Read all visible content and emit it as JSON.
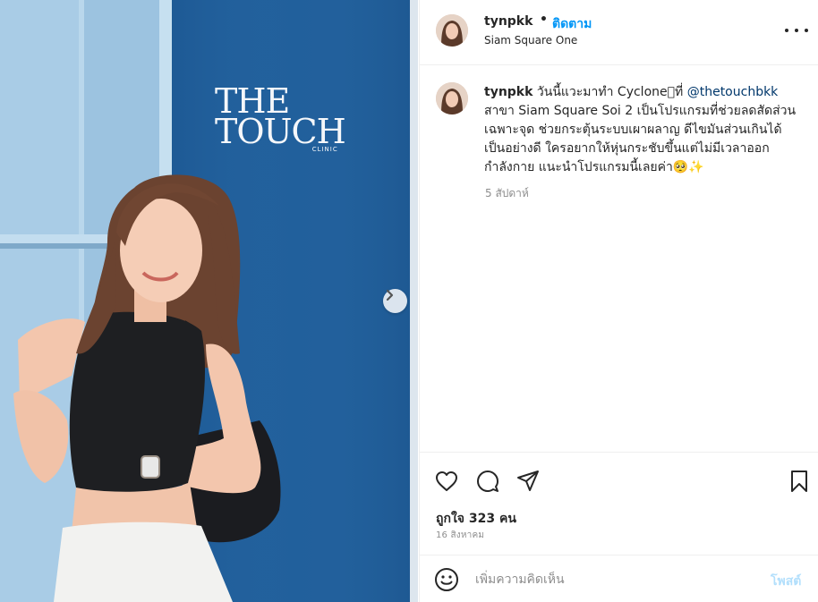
{
  "photo": {
    "sign_line1": "THE",
    "sign_line2": "TOUCH",
    "sign_line3": "CLINIC"
  },
  "header": {
    "username": "tynpkk",
    "separator": "•",
    "follow_label": "ติดตาม",
    "location": "Siam Square One"
  },
  "caption": {
    "username": "tynpkk",
    "text_before_mention": "วันนี้แวะมาทำ Cyclone⃣ที่ ",
    "mention": "@thetouchbkk",
    "text_after_mention": " สาขา Siam Square Soi 2 เป็นโปรแกรมที่ช่วยลดสัดส่วนเฉพาะจุด ช่วยกระตุ้นระบบเผาผลาญ ดีไขมันส่วนเกินได้เป็นอย่างดี ใครอยากให้หุ่นกระชับขึ้นแต่ไม่มีเวลาออกกำลังกาย แนะนำโปรแกรมนี้เลยค่า🥺✨",
    "age": "5 สัปดาห์"
  },
  "stats": {
    "likes": "ถูกใจ 323 คน",
    "date": "16 สิงหาคม"
  },
  "comment": {
    "placeholder": "เพิ่มความคิดเห็น",
    "post_label": "โพสต์"
  },
  "icons": {
    "like": "heart-icon",
    "comment": "comment-icon",
    "share": "paper-plane-icon",
    "save": "bookmark-icon",
    "emoji": "emoji-icon",
    "more": "more-icon",
    "next": "chevron-right-icon"
  },
  "colors": {
    "follow": "#0095f6",
    "mention": "#00376b",
    "post_disabled": "#b2dffc",
    "wall_blue": "#1f5f9b"
  }
}
